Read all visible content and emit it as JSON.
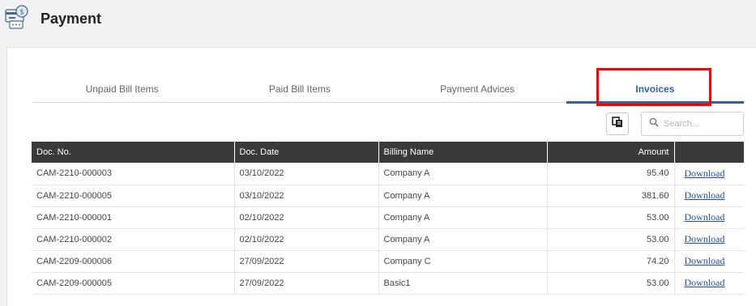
{
  "header": {
    "title": "Payment",
    "icon": "payment-card-icon"
  },
  "tabs": [
    {
      "label": "Unpaid Bill Items",
      "active": false
    },
    {
      "label": "Paid Bill Items",
      "active": false
    },
    {
      "label": "Payment Advices",
      "active": false
    },
    {
      "label": "Invoices",
      "active": true
    }
  ],
  "toolbar": {
    "copy_icon": "copy-icon",
    "search_icon": "search-icon",
    "search_placeholder": "Search...",
    "search_value": ""
  },
  "table": {
    "headers": {
      "doc_no": "Doc. No.",
      "doc_date": "Doc. Date",
      "billing_name": "Billing Name",
      "amount": "Amount",
      "action": ""
    },
    "rows": [
      {
        "doc_no": "CAM-2210-000003",
        "doc_date": "03/10/2022",
        "billing_name": "Company A",
        "amount": "95.40",
        "action": "Download"
      },
      {
        "doc_no": "CAM-2210-000005",
        "doc_date": "03/10/2022",
        "billing_name": "Company A",
        "amount": "381.60",
        "action": "Download"
      },
      {
        "doc_no": "CAM-2210-000001",
        "doc_date": "02/10/2022",
        "billing_name": "Company A",
        "amount": "53.00",
        "action": "Download"
      },
      {
        "doc_no": "CAM-2210-000002",
        "doc_date": "02/10/2022",
        "billing_name": "Company A",
        "amount": "53.00",
        "action": "Download"
      },
      {
        "doc_no": "CAM-2209-000006",
        "doc_date": "27/09/2022",
        "billing_name": "Company C",
        "amount": "74.20",
        "action": "Download"
      },
      {
        "doc_no": "CAM-2209-000005",
        "doc_date": "27/09/2022",
        "billing_name": "Basic1",
        "amount": "53.00",
        "action": "Download"
      }
    ]
  },
  "colors": {
    "accent": "#2e5fa8",
    "highlight": "#ff0000",
    "header_bg": "#3a3a3a",
    "link": "#1f4fb5"
  }
}
